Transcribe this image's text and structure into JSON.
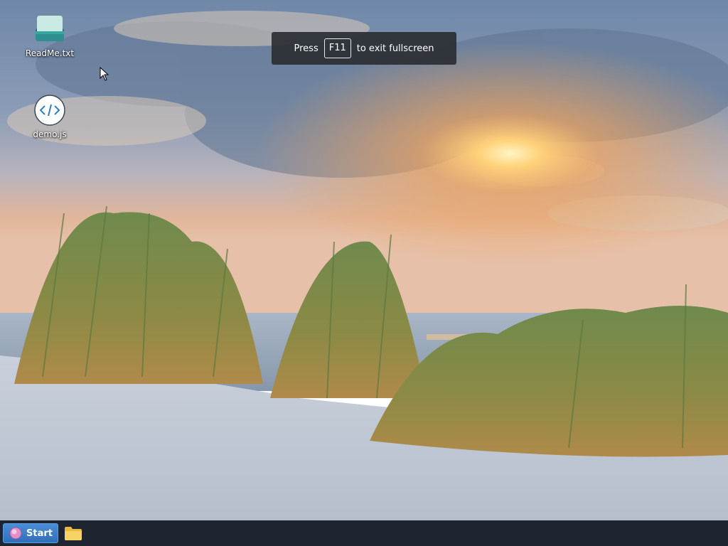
{
  "desktop": {
    "icons": [
      {
        "label": "ReadMe.txt",
        "icon": "text-file-icon"
      },
      {
        "label": "demo.js",
        "icon": "code-file-icon"
      }
    ]
  },
  "fullscreen_notice": {
    "before": "Press",
    "key": "F11",
    "after": "to exit fullscreen"
  },
  "taskbar": {
    "start_label": "Start",
    "pinned": [
      {
        "icon": "folder-icon"
      }
    ]
  },
  "colors": {
    "taskbar_bg": "#1e2430",
    "start_button": "#3a7dc9",
    "toast_bg": "#2d3035"
  }
}
